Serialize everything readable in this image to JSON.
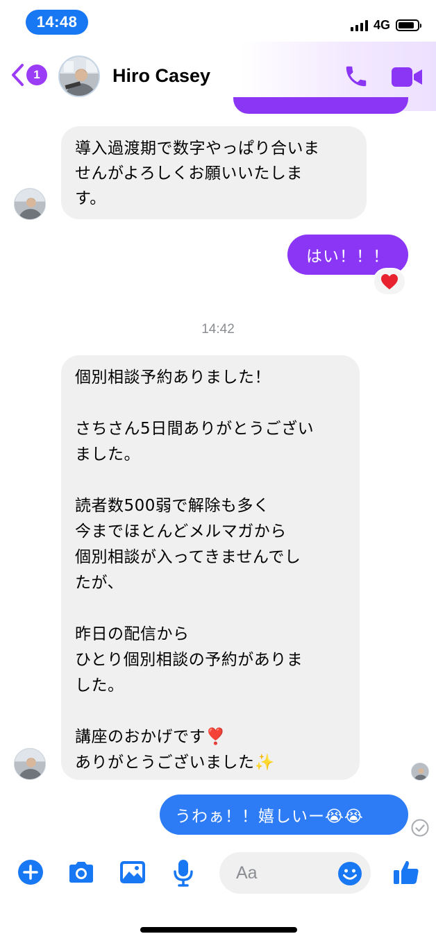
{
  "status_bar": {
    "time": "14:48",
    "network": "4G",
    "battery_level": 0.85
  },
  "header": {
    "back_badge_count": "1",
    "contact_name": "Hiro Casey",
    "icons": {
      "back": "chevron-left-icon",
      "call": "phone-icon",
      "video": "video-camera-icon"
    },
    "accent_color": "#8b36f5"
  },
  "messages": [
    {
      "direction": "incoming",
      "lines": [
        "導入過渡期で数字やっぱり合いま",
        "せんがよろしくお願いいたしま",
        "す。"
      ]
    },
    {
      "direction": "outgoing",
      "text": "はい！！！",
      "color": "#8b36f5",
      "reaction": "❤️"
    },
    {
      "type": "timestamp",
      "text": "14:42"
    },
    {
      "direction": "incoming",
      "lines": [
        "個別相談予約ありました！",
        "",
        "さちさん5日間ありがとうござい",
        "ました。",
        "",
        "読者数500弱で解除も多く",
        "今までほとんどメルマガから",
        "個別相談が入ってきませんでし",
        "たが、",
        "",
        "昨日の配信から",
        "ひとり個別相談の予約がありま",
        "した。",
        "",
        "講座のおかげです❣️",
        "ありがとうございました✨"
      ]
    },
    {
      "direction": "outgoing",
      "text": "うわぁ！！嬉しいー😭😭",
      "color": "#2d7cf5"
    }
  ],
  "composer": {
    "placeholder": "Aa",
    "icons": [
      "plus-icon",
      "camera-icon",
      "image-icon",
      "microphone-icon",
      "emoji-icon",
      "thumbs-up-icon"
    ],
    "accent_color": "#1877f2"
  }
}
